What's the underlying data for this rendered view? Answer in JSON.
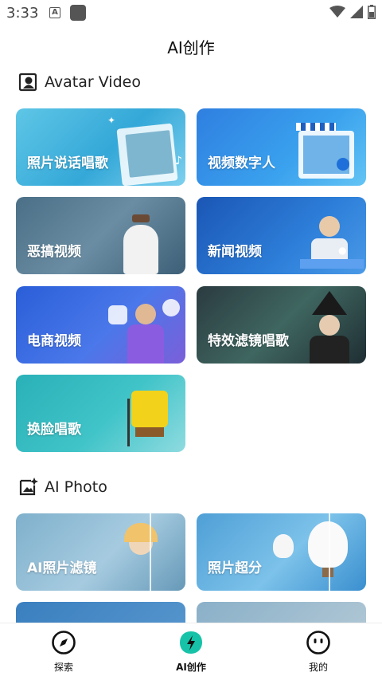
{
  "status_bar": {
    "time": "3:33",
    "notif_letter": "A"
  },
  "header": {
    "title": "AI创作"
  },
  "sections": [
    {
      "title": "Avatar Video",
      "cards": [
        {
          "label": "照片说话唱歌"
        },
        {
          "label": "视频数字人"
        },
        {
          "label": "恶搞视频"
        },
        {
          "label": "新闻视频"
        },
        {
          "label": "电商视频"
        },
        {
          "label": "特效滤镜唱歌"
        },
        {
          "label": "换脸唱歌"
        }
      ]
    },
    {
      "title": "AI Photo",
      "cards": [
        {
          "label": "AI照片滤镜"
        },
        {
          "label": "照片超分"
        }
      ]
    }
  ],
  "tabs": [
    {
      "label": "探索",
      "icon": "compass-icon",
      "active": false
    },
    {
      "label": "AI创作",
      "icon": "lightning-icon",
      "active": true
    },
    {
      "label": "我的",
      "icon": "smiley-icon",
      "active": false
    }
  ],
  "colors": {
    "accent": "#17c3a8",
    "text": "#111111"
  }
}
